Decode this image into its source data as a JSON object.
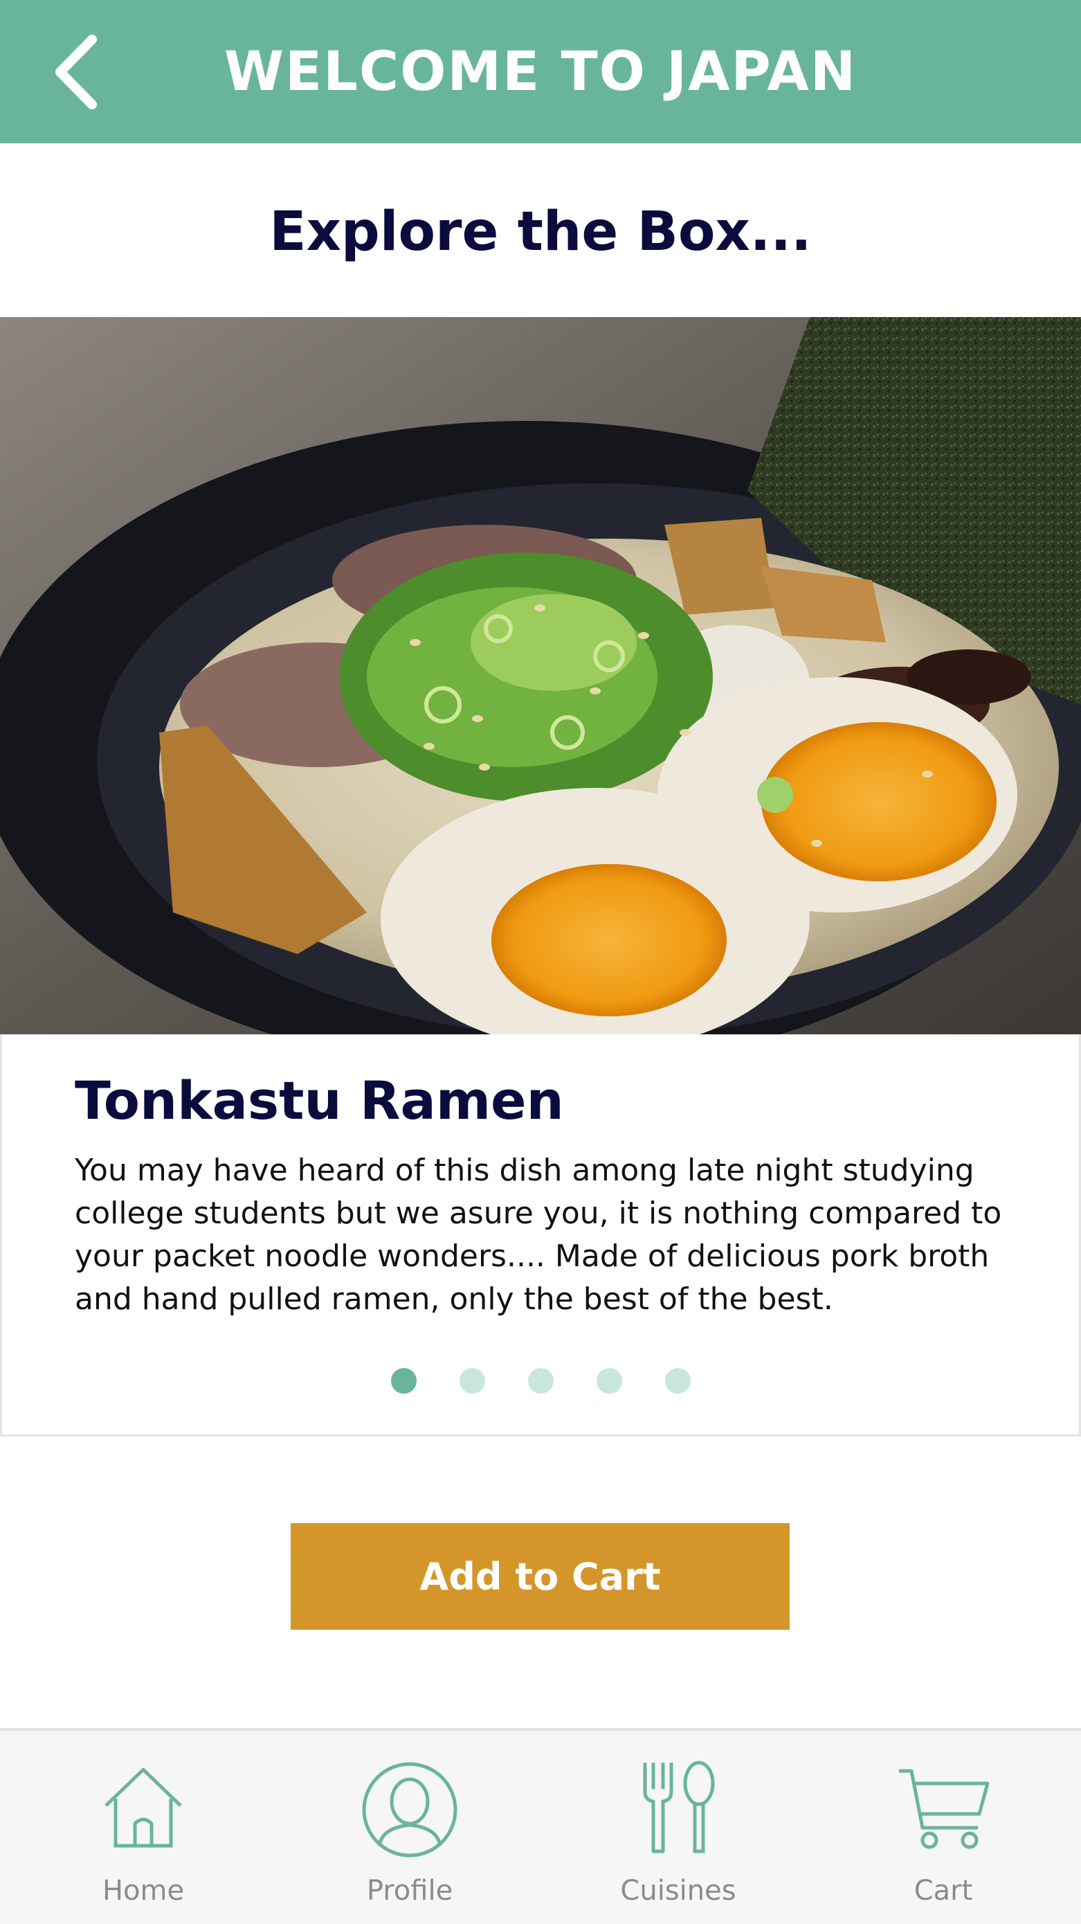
{
  "header": {
    "title": "WELCOME TO JAPAN",
    "back_icon": "chevron-left-icon",
    "color": "#68b59b"
  },
  "section": {
    "heading": "Explore the Box..."
  },
  "carousel": {
    "image_alt": "Bowl of tonkotsu ramen with soft-boiled eggs, scallions and nori",
    "item": {
      "title": "Tonkastu Ramen",
      "description": "You may have heard of this dish among late night studying college students but we asure you, it is nothing compared to your packet noodle wonders.... Made of delicious pork broth and hand pulled ramen, only the best of the best."
    },
    "slide_count": 5,
    "active_index": 0
  },
  "cart_button": {
    "label": "Add to Cart",
    "color": "#d4962a"
  },
  "tabbar": {
    "tabs": [
      {
        "label": "Home",
        "icon": "home-icon"
      },
      {
        "label": "Profile",
        "icon": "profile-icon"
      },
      {
        "label": "Cuisines",
        "icon": "fork-spoon-icon"
      },
      {
        "label": "Cart",
        "icon": "cart-icon"
      }
    ],
    "icon_color": "#68b59b"
  },
  "colors": {
    "heading_text": "#0b0b3e",
    "dot_inactive": "#c9e6dc"
  }
}
